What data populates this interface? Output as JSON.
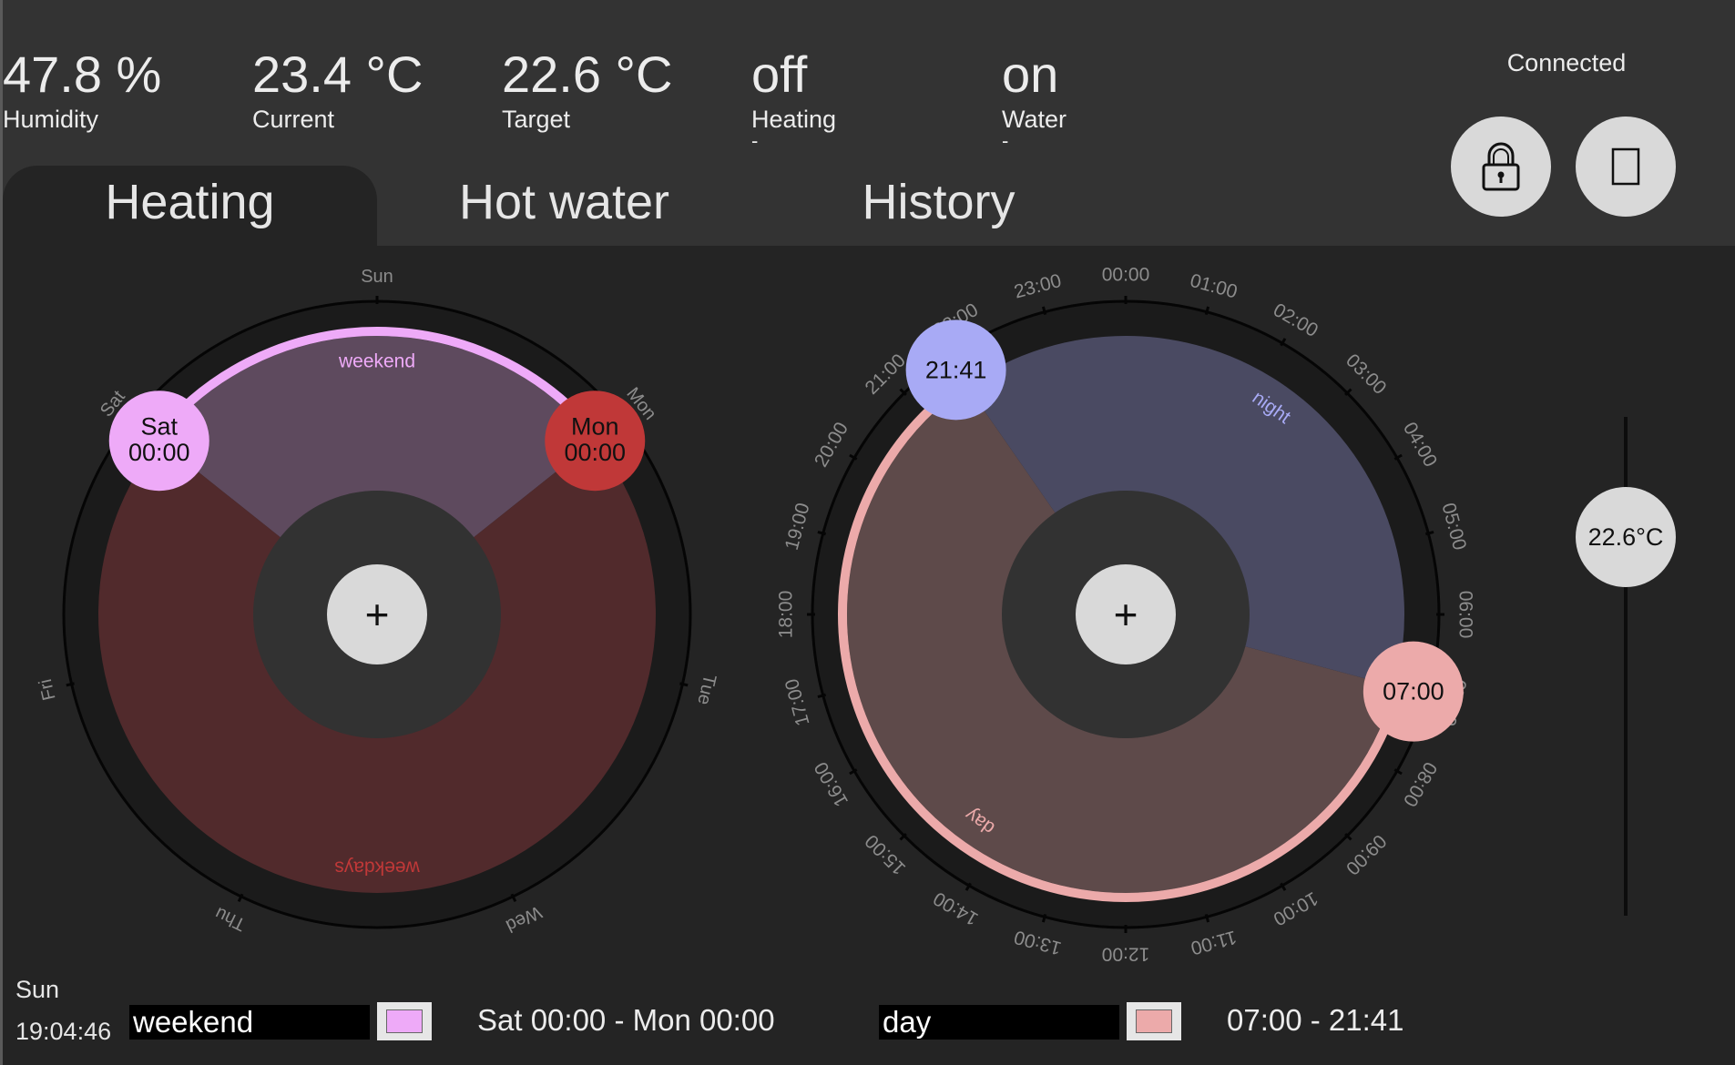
{
  "stats": {
    "humidity": {
      "value": "47.8 %",
      "label": "Humidity"
    },
    "current": {
      "value": "23.4 °C",
      "label": "Current"
    },
    "target": {
      "value": "22.6 °C",
      "label": "Target"
    },
    "heating": {
      "value": "off",
      "label": "Heating",
      "sub": "-"
    },
    "water": {
      "value": "on",
      "label": "Water",
      "sub": "-"
    }
  },
  "connection": {
    "status": "Connected"
  },
  "buttons": {
    "lock_icon": "lock-icon",
    "square_icon": "square-icon"
  },
  "tabs": [
    {
      "label": "Heating",
      "active": true
    },
    {
      "label": "Hot water",
      "active": false
    },
    {
      "label": "History",
      "active": false
    }
  ],
  "week_dial": {
    "day_labels": [
      "Sun",
      "Mon",
      "Tue",
      "Wed",
      "Thu",
      "Fri",
      "Sat"
    ],
    "segments": [
      {
        "name": "weekend",
        "start": "Sat 00:00",
        "end": "Mon 00:00",
        "color": "#eeaaf8",
        "fill": "#5e4a5e",
        "selected": true
      },
      {
        "name": "weekdays",
        "start": "Mon 00:00",
        "end": "Sat 00:00",
        "color": "#c03838",
        "fill": "#512a2c",
        "selected": false
      }
    ],
    "handles": [
      {
        "day": "Sat",
        "time": "00:00",
        "color": "#eeaaf8"
      },
      {
        "day": "Mon",
        "time": "00:00",
        "color": "#c03838"
      }
    ],
    "add_label": "+"
  },
  "day_dial": {
    "hour_labels": [
      "00:00",
      "01:00",
      "02:00",
      "03:00",
      "04:00",
      "05:00",
      "06:00",
      "07:00",
      "08:00",
      "09:00",
      "10:00",
      "11:00",
      "12:00",
      "13:00",
      "14:00",
      "15:00",
      "16:00",
      "17:00",
      "18:00",
      "19:00",
      "20:00",
      "21:00",
      "22:00",
      "23:00"
    ],
    "segments": [
      {
        "name": "day",
        "start": "07:00",
        "end": "21:41",
        "color": "#ecaaaa",
        "fill": "#5e4a4a",
        "selected": true
      },
      {
        "name": "night",
        "start": "21:41",
        "end": "07:00",
        "color": "#a8aaf5",
        "fill": "#4a4a62",
        "selected": false
      }
    ],
    "handles": [
      {
        "time": "21:41",
        "color": "#a8aaf5"
      },
      {
        "time": "07:00",
        "color": "#ecaaaa"
      }
    ],
    "add_label": "+"
  },
  "target_slider": {
    "label": "22.6°C",
    "value": 22.6
  },
  "clock": {
    "day": "Sun",
    "time": "19:04:46"
  },
  "week_editor": {
    "name": "weekend",
    "color": "#eeaaf8",
    "range": "Sat 00:00 - Mon 00:00"
  },
  "day_editor": {
    "name": "day",
    "color": "#ecaaaa",
    "range": "07:00 - 21:41"
  }
}
